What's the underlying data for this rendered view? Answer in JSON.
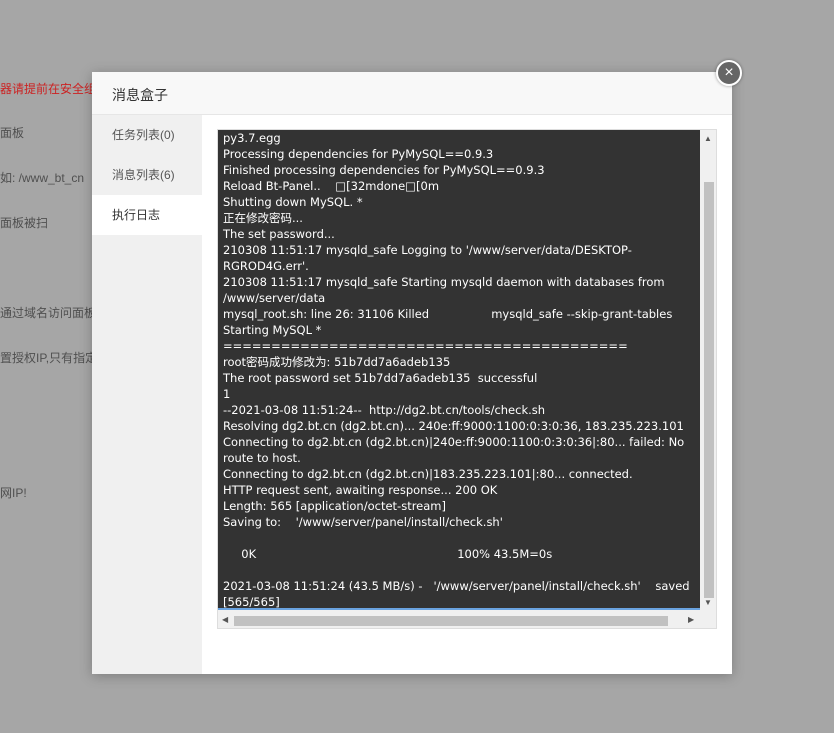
{
  "background": {
    "lines": [
      "器请提前在安全组",
      "面板",
      "如: /www_bt_cn",
      "面板被扫",
      "通过域名访问面板!",
      "置授权IP,只有指定",
      "网IP!"
    ]
  },
  "dialog": {
    "title": "消息盒子",
    "close_label": "×"
  },
  "sidebar": {
    "items": [
      {
        "label": "任务列表(0)"
      },
      {
        "label": "消息列表(6)"
      },
      {
        "label": "执行日志"
      }
    ]
  },
  "log": {
    "lines": [
      "py3.7.egg",
      "Processing dependencies for PyMySQL==0.9.3",
      "Finished processing dependencies for PyMySQL==0.9.3",
      "Reload Bt-Panel..    □[32mdone□[0m",
      "Shutting down MySQL. *",
      "正在修改密码...",
      "The set password...",
      "210308 11:51:17 mysqld_safe Logging to '/www/server/data/DESKTOP-",
      "RGROD4G.err'.",
      "210308 11:51:17 mysqld_safe Starting mysqld daemon with databases from",
      "/www/server/data",
      "mysql_root.sh: line 26: 31106 Killed                 mysqld_safe --skip-grant-tables",
      "Starting MySQL *",
      "==========================================",
      "root密码成功修改为: 51b7dd7a6adeb135",
      "The root password set 51b7dd7a6adeb135  successful",
      "1",
      "--2021-03-08 11:51:24--  http://dg2.bt.cn/tools/check.sh",
      "Resolving dg2.bt.cn (dg2.bt.cn)... 240e:ff:9000:1100:0:3:0:36, 183.235.223.101",
      "Connecting to dg2.bt.cn (dg2.bt.cn)|240e:ff:9000:1100:0:3:0:36|:80... failed: No",
      "route to host.",
      "Connecting to dg2.bt.cn (dg2.bt.cn)|183.235.223.101|:80... connected.",
      "HTTP request sent, awaiting response... 200 OK",
      "Length: 565 [application/octet-stream]",
      "Saving to:    '/www/server/panel/install/check.sh'",
      "",
      "     0K                                                       100% 43.5M=0s",
      "",
      "2021-03-08 11:51:24 (43.5 MB/s) -   '/www/server/panel/install/check.sh'    saved",
      "[565/565]"
    ]
  },
  "scroll": {
    "up": "▲",
    "down": "▼",
    "left": "◀",
    "right": "▶"
  }
}
